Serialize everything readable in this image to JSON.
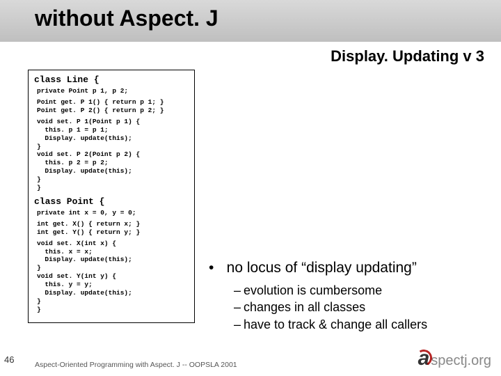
{
  "title": "without Aspect. J",
  "subtitle": "Display. Updating v 3",
  "class_line_header": "class Line {",
  "code_line_private": "private Point p 1, p 2;",
  "code_line_get": "Point get. P 1() { return p 1; }\nPoint get. P 2() { return p 2; }",
  "code_line_set": "void set. P 1(Point p 1) {\n  this. p 1 = p 1;\n  Display. update(this);\n}\nvoid set. P 2(Point p 2) {\n  this. p 2 = p 2;\n  Display. update(this);\n}\n}",
  "class_point_header": "class Point {",
  "code_point_private": "private int x = 0, y = 0;",
  "code_point_get": "int get. X() { return x; }\nint get. Y() { return y; }",
  "code_point_set": "void set. X(int x) {\n  this. x = x;\n  Display. update(this);\n}\nvoid set. Y(int y) {\n  this. y = y;\n  Display. update(this);\n}\n}",
  "bullet_main": "no locus of “display updating”",
  "sub_bullets": [
    "evolution is cumbersome",
    "changes in all classes",
    "have to track & change all callers"
  ],
  "slide_number": "46",
  "footer_text": "Aspect-Oriented Programming with Aspect. J -- OOPSLA 2001",
  "logo_a": "a",
  "logo_rest": "spectj.org"
}
